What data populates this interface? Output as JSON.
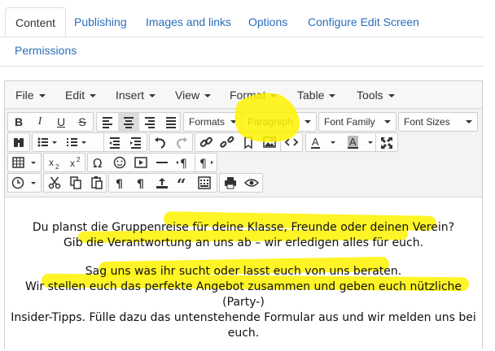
{
  "tabs": {
    "items": [
      "Content",
      "Publishing",
      "Images and links",
      "Options",
      "Configure Edit Screen",
      "Permissions"
    ],
    "active": "Content"
  },
  "menubar": {
    "file": "File",
    "edit": "Edit",
    "insert": "Insert",
    "view": "View",
    "format": "Format",
    "table": "Table",
    "tools": "Tools"
  },
  "toolbar": {
    "formats": "Formats",
    "paragraph": "Paragraph",
    "font_family": "Font Family",
    "font_sizes": "Font Sizes",
    "bold": "B",
    "italic": "I",
    "underline": "U",
    "strike": "S"
  },
  "content": {
    "para1_line1": "Du planst die Gruppenreise für deine Klasse, Freunde oder deinen Verein?",
    "para1_line2": "Gib die Verantwortung an uns ab – wir erledigen alles für euch.",
    "para2_line1": "Sag uns was ihr sucht oder lasst euch von uns beraten.",
    "para2_line2": "Wir stellen euch das perfekte Angebot zusammen und geben euch nützliche (Party-)",
    "para2_line3": "Insider-Tipps. Fülle dazu das untenstehende Formular aus und wir melden uns bei",
    "para2_line4": "euch."
  },
  "colors": {
    "highlight": "#fff200",
    "tab_link": "#2a6ebb",
    "border": "#cfcfcf"
  }
}
